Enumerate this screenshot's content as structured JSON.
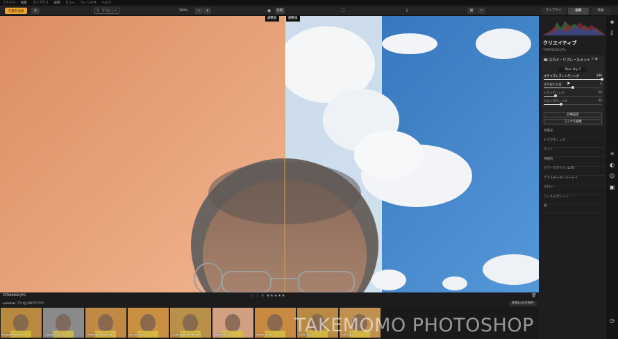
{
  "menu": [
    "ファイル",
    "編集",
    "ライブラリ",
    "画像",
    "ビュー",
    "ウィンドウ",
    "ヘルプ"
  ],
  "toolbar": {
    "add_photos": "写真を追加",
    "add_icon": "+",
    "preset_label": "プリセット",
    "zoom_value": "100%",
    "zoom_out": "−",
    "zoom_in": "+",
    "compare_label": "比較",
    "tabs": [
      "ライブラリ",
      "編集",
      "情報"
    ],
    "active_tab": "編集"
  },
  "canvas": {
    "before_label": "調整前",
    "after_label": "調整後",
    "colors": {
      "before_bg": "#e7a27c",
      "sky": "#3f82c9",
      "divider": "#d7a04a"
    }
  },
  "bottom": {
    "filename": "TATW0006.JPG",
    "rating_icons": "◌ ♡ ✕ ★★★★★",
    "presets_label": "Luminar プリセット",
    "presets_category": "Essentials",
    "save_look": "新規Lookを保存"
  },
  "filmstrip": {
    "thumbs": [
      {
        "name": "Image Enhancer",
        "tone": "#b88a40"
      },
      {
        "name": "Classic B&W",
        "tone": "#8a8a8a"
      },
      {
        "name": "Dramatic Enhancer",
        "tone": "#c08a45"
      },
      {
        "name": "Golden Hour",
        "tone": "#c89040"
      },
      {
        "name": "Landscape Enhancer",
        "tone": "#b8904a"
      },
      {
        "name": "Portrait Glow",
        "tone": "#d0a080"
      },
      {
        "name": "Warm Tones",
        "tone": "#c88a40"
      },
      {
        "name": "Vivid Color",
        "tone": "#b88a44"
      },
      {
        "name": "Soft Light",
        "tone": "#c09050"
      }
    ]
  },
  "watermark": "TAKEMOMO PHOTOSHOP",
  "panel": {
    "title": "クリエイティブ",
    "file": "TATW0006.JPG",
    "ai_badge": "AI",
    "tool_name": "スカイ・リプレースメント",
    "sky_selection": "Blue Sky 2",
    "sliders": [
      {
        "label": "ホライズンブレンディング",
        "value": "200",
        "fraction": 1.0,
        "active": true
      },
      {
        "label": "地平線の位置",
        "value": "0",
        "fraction": 0.5,
        "active": false
      },
      {
        "label": "リライティング",
        "value": "20",
        "fraction": 0.2,
        "active": false
      },
      {
        "label": "スカイグローバル",
        "value": "30",
        "fraction": 0.3,
        "active": false
      }
    ],
    "advanced_button": "詳細設定",
    "mask_button": "マスクを編集",
    "tools": [
      "太陽光",
      "ドラマティック",
      "マット",
      "神秘的",
      "カラースタイル (LUT)",
      "テクスチャオーバーレイ",
      "グロー",
      "フィルムグレイン",
      "霧"
    ]
  }
}
